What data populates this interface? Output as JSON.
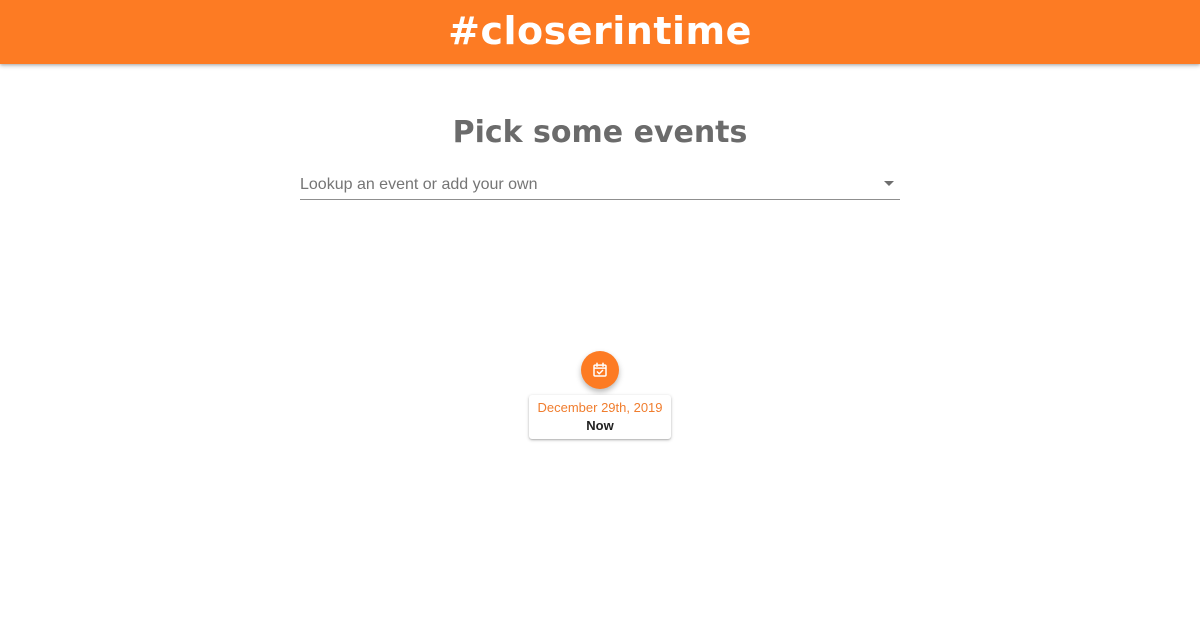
{
  "app_bar": {
    "title": "#closerintime",
    "color": "#fd7b23"
  },
  "main": {
    "heading": "Pick some events",
    "event_select": {
      "placeholder": "Lookup an event or add your own",
      "icon": "dropdown-arrow-icon"
    }
  },
  "timeline": {
    "marker_icon": "calendar-check-icon",
    "accent_color": "#fd7b23",
    "events": [
      {
        "date": "December 29th, 2019",
        "name": "Now"
      }
    ]
  }
}
